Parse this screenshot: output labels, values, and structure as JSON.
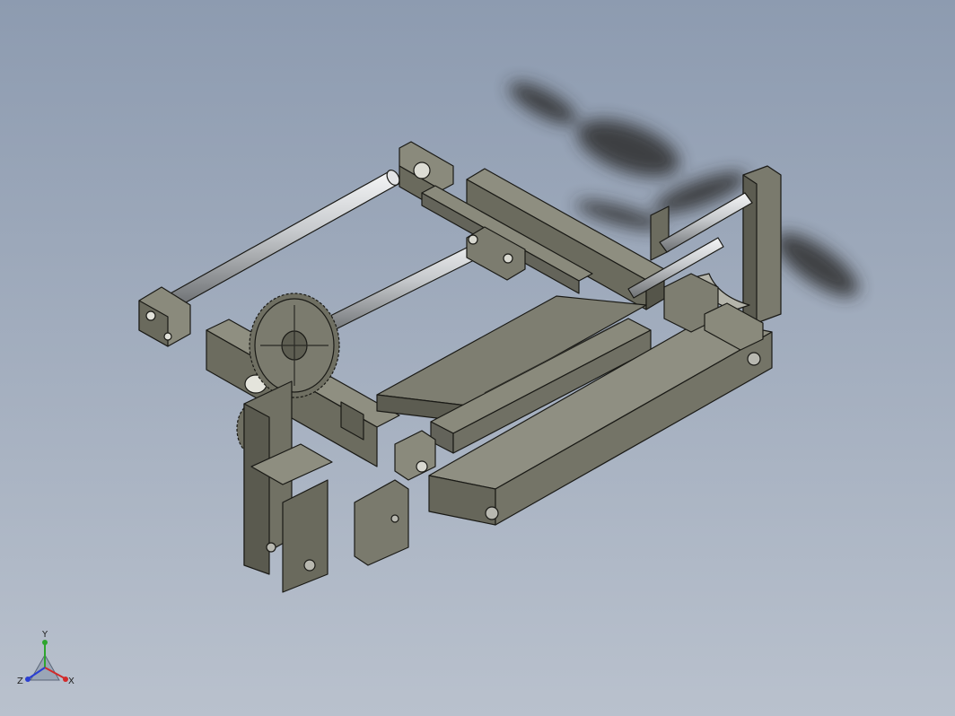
{
  "viewport": {
    "background_top": "#8d9bb0",
    "background_bottom": "#b9c1cd",
    "model_color": "#6f6f62",
    "model_edge_color": "#1a1a16",
    "rod_color": "#c9cccf"
  },
  "triad": {
    "x_label": "X",
    "y_label": "Y",
    "z_label": "Z",
    "x_color": "#d22a2a",
    "y_color": "#2fa52f",
    "z_color": "#2a3fd2"
  }
}
